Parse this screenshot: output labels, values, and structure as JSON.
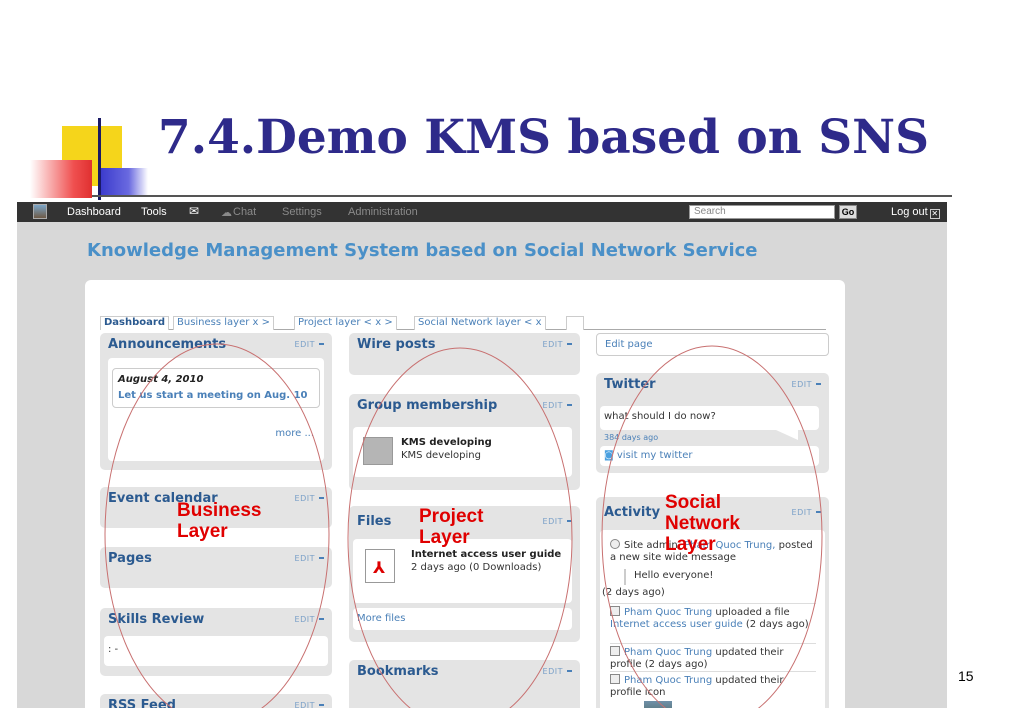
{
  "slide": {
    "title": "7.4.Demo KMS based on SNS",
    "page_number": "15"
  },
  "topbar": {
    "nav_items": [
      "Dashboard",
      "Tools",
      "Chat",
      "Settings",
      "Administration"
    ],
    "search_placeholder": "Search",
    "go_label": "Go",
    "logout_label": "Log out"
  },
  "site_heading": "Knowledge Management System based on Social Network Service",
  "tabs": [
    {
      "label": "Dashboard"
    },
    {
      "label": "Business layer   x  >"
    },
    {
      "label": "Project layer  < x  >"
    },
    {
      "label": "Social Network layer  < x"
    }
  ],
  "edit_label": "EDIT",
  "left_column": {
    "announcements": {
      "title": "Announcements",
      "date": "August 4, 2010",
      "text": "Let us start a meeting on Aug. 10",
      "more": "more ..."
    },
    "event_calendar": {
      "title": "Event calendar"
    },
    "pages": {
      "title": "Pages"
    },
    "skills_review": {
      "title": "Skills Review",
      "body": ": -"
    },
    "rss_feed": {
      "title": "RSS Feed"
    }
  },
  "middle_column": {
    "wire_posts": {
      "title": "Wire posts"
    },
    "group_membership": {
      "title": "Group membership",
      "group_name": "KMS developing",
      "group_desc": "KMS developing"
    },
    "files": {
      "title": "Files",
      "file_name": "Internet access user guide",
      "file_meta": "2 days ago (0 Downloads)",
      "more_files": "More files"
    },
    "bookmarks": {
      "title": "Bookmarks"
    }
  },
  "right_column": {
    "edit_page": "Edit page",
    "twitter": {
      "title": "Twitter",
      "tweet": "what should I do now?",
      "age": "384 days ago",
      "visit": "visit my twitter"
    },
    "activity": {
      "title": "Activity",
      "item1_prefix": "Site admin,",
      "item1_user": "Pham Quoc Trung,",
      "item1_text": "posted a new site wide message",
      "item1_message": "Hello everyone!",
      "item1_time": "(2 days ago)",
      "item2_user": "Pham Quoc Trung",
      "item2_text": "uploaded a file",
      "item2_link": "Internet access user guide",
      "item2_time": "(2 days ago)",
      "item3_user": "Pham Quoc Trung",
      "item3_text": "updated their profile",
      "item3_time": "(2 days ago)",
      "item4_user": "Pham Quoc Trung",
      "item4_text": "updated their profile icon"
    }
  },
  "overlay_labels": {
    "business": "Business\nLayer",
    "project": "Project\nLayer",
    "social": "Social\nNetwork\nLayer"
  },
  "colors": {
    "title": "#2e2a8a",
    "overlay_label": "#e00000",
    "link": "#4a80b8",
    "heading": "#4a90c8"
  }
}
